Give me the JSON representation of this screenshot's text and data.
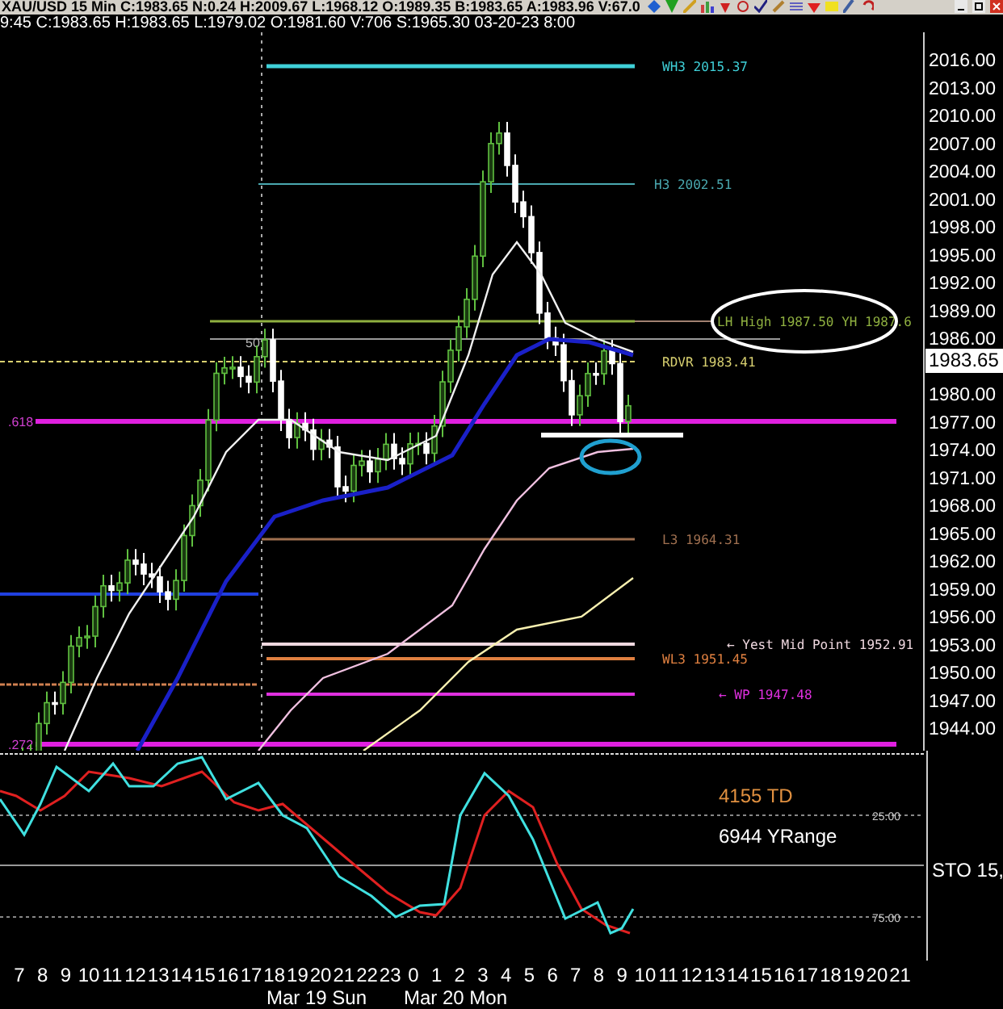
{
  "header": {
    "quote_line": "XAU/USD 15 Min C:1983.65 N:0.24 H:2009.67 L:1968.12 O:1989.35 B:1983.65 A:1983.96 V:67.0",
    "bar_line": "9:45 C:1983.65 H:1983.65 L:1979.02 O:1981.60 V:706 S:1965.30 03-20-23 8:00"
  },
  "price_axis": {
    "labels": [
      "2016.00",
      "2013.00",
      "2010.00",
      "2007.00",
      "2004.00",
      "2001.00",
      "1998.00",
      "1995.00",
      "1992.00",
      "1989.00",
      "1986.00",
      "1980.00",
      "1977.00",
      "1974.00",
      "1971.00",
      "1968.00",
      "1965.00",
      "1962.00",
      "1959.00",
      "1956.00",
      "1953.00",
      "1950.00",
      "1947.00",
      "1944.00"
    ],
    "current_price": "1983.65"
  },
  "levels": [
    {
      "label": "WH3 2015.37",
      "color": "#3fd0d8"
    },
    {
      "label": "H3 2002.51",
      "color": "#4aa8b0"
    },
    {
      "label": "LH High 1987.50 YH 1987.6",
      "color": "#8fb040"
    },
    {
      "label": "RDVR 1983.41",
      "color": "#d8d070"
    },
    {
      "label": "L3 1964.31",
      "color": "#a07050"
    },
    {
      "label": "← Yest Mid Point 1952.91",
      "color": "#f0d8e0"
    },
    {
      "label": "WL3 1951.45",
      "color": "#e08040"
    },
    {
      "label": "← WP 1947.48",
      "color": "#e030e0"
    }
  ],
  "fib_labels": [
    ".618",
    ".272",
    "50"
  ],
  "indicator": {
    "td": "4155 TD",
    "yrange": "6944 YRange",
    "name": "STO 15,",
    "levels": [
      "25.00",
      "75.00"
    ]
  },
  "time_axis": {
    "hours": [
      "7",
      "8",
      "9",
      "10",
      "11",
      "12",
      "13",
      "14",
      "15",
      "16",
      "17",
      "18",
      "19",
      "20",
      "21",
      "22",
      "23",
      "0",
      "1",
      "2",
      "3",
      "4",
      "5",
      "6",
      "7",
      "8",
      "9",
      "10",
      "11",
      "12",
      "13",
      "14",
      "15",
      "16",
      "17",
      "18",
      "19",
      "20",
      "21"
    ],
    "days": [
      "Mar 19 Sun",
      "Mar 20 Mon"
    ]
  }
}
